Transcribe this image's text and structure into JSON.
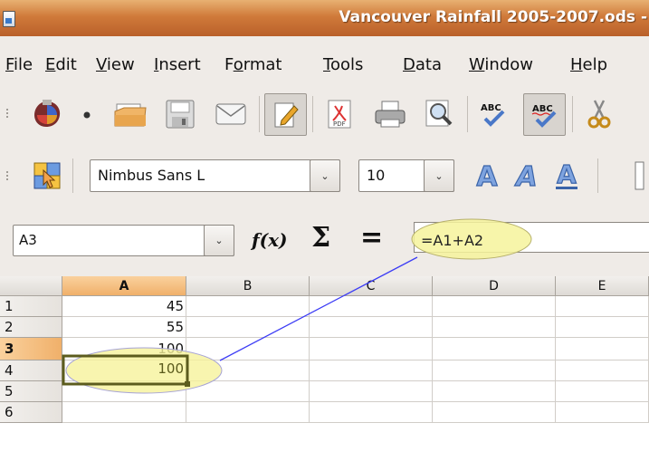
{
  "window": {
    "title": "Vancouver Rainfall 2005-2007.ods -"
  },
  "menu": {
    "items": [
      {
        "mnemonic": "F",
        "rest": "ile"
      },
      {
        "mnemonic": "E",
        "rest": "dit"
      },
      {
        "mnemonic": "V",
        "rest": "iew"
      },
      {
        "mnemonic": "I",
        "rest": "nsert"
      },
      {
        "pre": "F",
        "mnemonic": "o",
        "rest": "rmat"
      },
      {
        "mnemonic": "T",
        "rest": "ools"
      },
      {
        "mnemonic": "D",
        "rest": "ata"
      },
      {
        "mnemonic": "W",
        "rest": "indow"
      },
      {
        "mnemonic": "H",
        "rest": "elp"
      }
    ]
  },
  "toolbar": {
    "icons": [
      "new-document-icon",
      "open-folder-icon",
      "save-icon",
      "email-icon",
      "edit-file-icon",
      "export-pdf-icon",
      "print-icon",
      "print-preview-icon",
      "spellcheck-icon",
      "autospellcheck-icon",
      "cut-icon"
    ],
    "autospellcheck_pressed": true,
    "edit_file_pressed": true
  },
  "format": {
    "font_name": "Nimbus Sans L",
    "font_size": "10",
    "icons": [
      "styles-icon",
      "bold-icon",
      "italic-icon",
      "underline-icon"
    ]
  },
  "formula": {
    "name_box": "A3",
    "function_wizard_label": "f(x)",
    "sum_label": "Σ",
    "function_label": "=",
    "content": "=A1+A2"
  },
  "sheet": {
    "columns": [
      "A",
      "B",
      "C",
      "D",
      "E"
    ],
    "selected_column": "A",
    "rows": [
      {
        "label": "1",
        "cells": [
          "45",
          "",
          "",
          "",
          ""
        ]
      },
      {
        "label": "2",
        "cells": [
          "55",
          "",
          "",
          "",
          ""
        ]
      },
      {
        "label": "3",
        "cells": [
          "100",
          "",
          "",
          "",
          ""
        ]
      },
      {
        "label": "4",
        "cells": [
          "",
          "",
          "",
          "",
          ""
        ]
      },
      {
        "label": "5",
        "cells": [
          "",
          "",
          "",
          "",
          ""
        ]
      },
      {
        "label": "6",
        "cells": [
          "",
          "",
          "",
          "",
          ""
        ]
      }
    ],
    "selected_row": "3",
    "active_cell": "A3"
  },
  "colors": {
    "title_gradient_top": "#e8b072",
    "title_gradient_bottom": "#b9602a",
    "highlight_ellipse": "#f6f39b",
    "connector_line": "#3c3cf5",
    "active_cell_border": "#5c5c1e",
    "selected_header": "#f0b06a"
  }
}
